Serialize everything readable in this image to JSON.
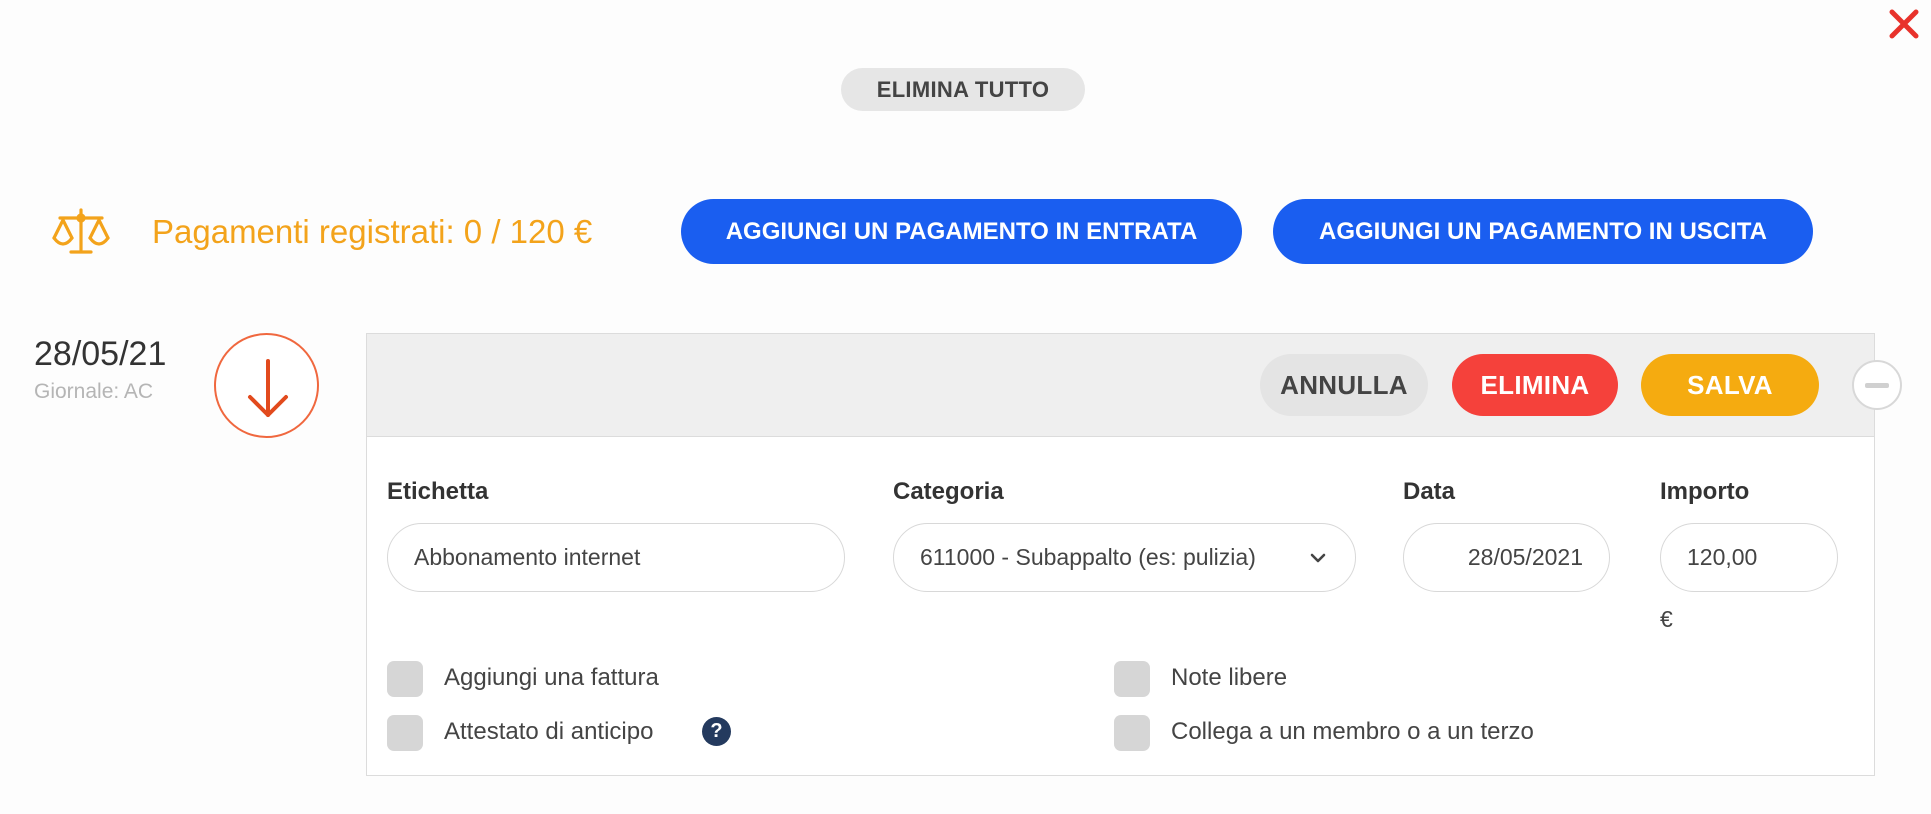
{
  "header": {
    "close_icon": "close-x-icon",
    "delete_all_label": "ELIMINA TUTTO"
  },
  "summary": {
    "registered_label": "Pagamenti registrati: 0 / 120 €",
    "add_incoming_label": "AGGIUNGI UN PAGAMENTO IN ENTRATA",
    "add_outgoing_label": "AGGIUNGI UN PAGAMENTO IN USCITA"
  },
  "entry": {
    "date": "28/05/21",
    "journal": "Giornale: AC",
    "direction_icon": "arrow-down-icon",
    "actions": {
      "cancel_label": "ANNULLA",
      "delete_label": "ELIMINA",
      "save_label": "SALVA"
    },
    "fields": {
      "etichetta_label": "Etichetta",
      "etichetta_value": "Abbonamento internet",
      "categoria_label": "Categoria",
      "categoria_value": "611000 - Subappalto (es: pulizia)",
      "data_label": "Data",
      "data_value": "28/05/2021",
      "importo_label": "Importo",
      "importo_value": "120,00",
      "currency": "€"
    },
    "options": {
      "add_invoice": "Aggiungi una fattura",
      "advance_certificate": "Attestato di anticipo",
      "help_symbol": "?",
      "free_notes": "Note libere",
      "link_member": "Collega a un membro o a un terzo"
    }
  },
  "colors": {
    "accent_orange": "#f3a31b",
    "primary_blue": "#1a5ef0",
    "danger_red": "#f5413b",
    "save_yellow": "#f5ab10",
    "close_red": "#e8322b"
  }
}
